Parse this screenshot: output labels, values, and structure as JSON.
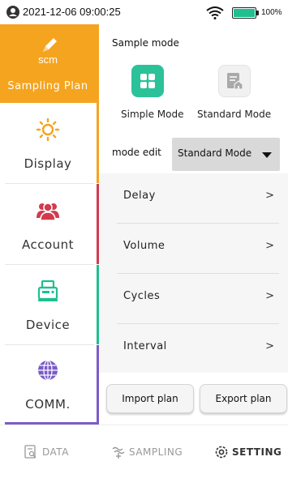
{
  "status": {
    "datetime": "2021-12-06 09:00:25",
    "battery_percent": "100%",
    "battery_level": 1.0
  },
  "nav": {
    "items": [
      {
        "logo_text": "scm",
        "label": "Sampling Plan",
        "icon": "pen-icon",
        "active": true,
        "accent": "#f5a420"
      },
      {
        "label": "Display",
        "icon": "sun-icon",
        "accent": "#f5a420"
      },
      {
        "label": "Account",
        "icon": "users-icon",
        "accent": "#d23b4e"
      },
      {
        "label": "Device",
        "icon": "device-icon",
        "accent": "#1fbf90"
      },
      {
        "label": "COMM.",
        "icon": "globe-icon",
        "accent": "#7b5cc8"
      }
    ]
  },
  "panel": {
    "sample_title": "Sample mode",
    "modes": [
      {
        "label": "Simple Mode",
        "icon": "grid-icon",
        "color": "#2bc29a"
      },
      {
        "label": "Standard Mode",
        "icon": "document-home-icon",
        "color": "#f1f1f1"
      }
    ],
    "mode_edit_label": "mode edit",
    "mode_edit_value": "Standard Mode",
    "settings": [
      {
        "label": "Delay",
        "chevron": ">"
      },
      {
        "label": "Volume",
        "chevron": ">"
      },
      {
        "label": "Cycles",
        "chevron": ">"
      },
      {
        "label": "Interval",
        "chevron": ">"
      }
    ],
    "import_label": "Import plan",
    "export_label": "Export plan"
  },
  "tabs": {
    "data": "DATA",
    "sampling": "SAMPLING",
    "setting": "SETTING"
  },
  "colors": {
    "accent": "#f5a420",
    "green": "#2bc29a",
    "red": "#d23b4e",
    "purple": "#7b5cc8"
  }
}
